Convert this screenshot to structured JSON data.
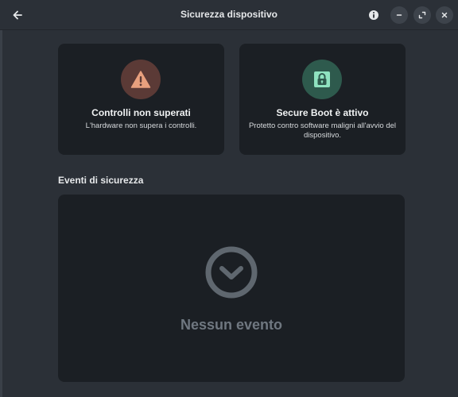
{
  "header": {
    "title": "Sicurezza dispositivo"
  },
  "cards": [
    {
      "icon": "warning-icon",
      "status": "error",
      "title": "Controlli non superati",
      "description": "L'hardware non supera i controlli."
    },
    {
      "icon": "lock-icon",
      "status": "ok",
      "title": "Secure Boot è attivo",
      "description": "Protetto contro software maligni all'avvio del dispositivo."
    }
  ],
  "events": {
    "section_title": "Eventi di sicurezza",
    "empty_icon": "clock-icon",
    "empty_text": "Nessun evento"
  },
  "colors": {
    "warning_accent": "#e8a07e",
    "ok_accent": "#8fe3c0"
  }
}
